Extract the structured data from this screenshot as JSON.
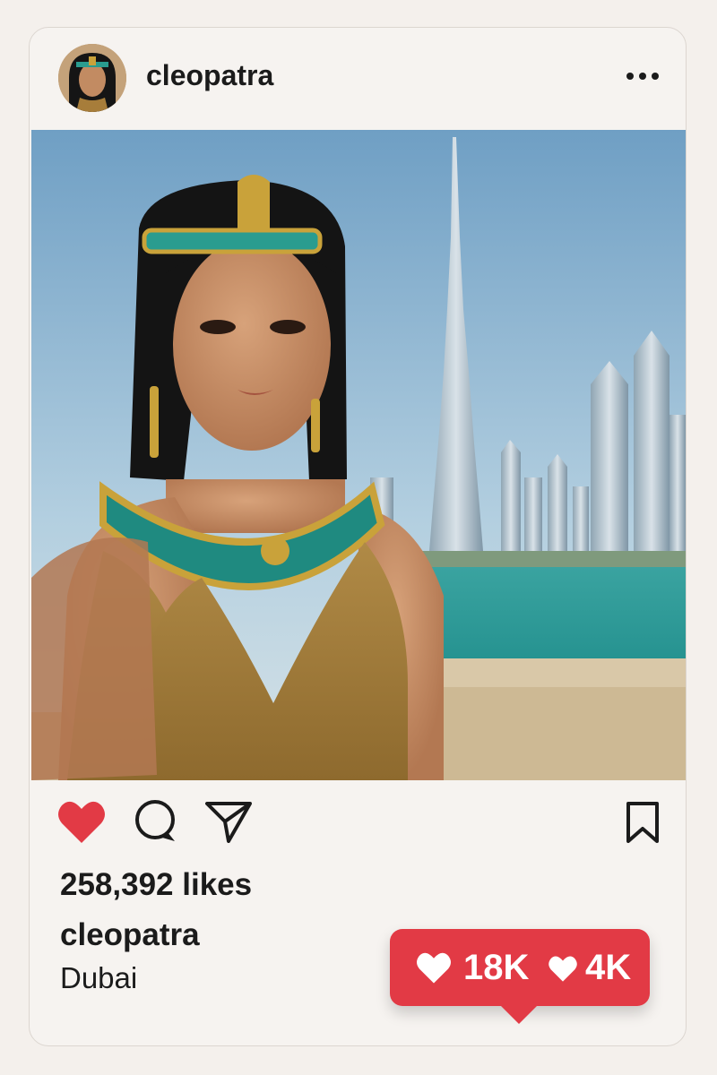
{
  "post": {
    "username": "cleopatra",
    "likes_text": "258,392 likes",
    "caption_username": "cleopatra",
    "location": "Dubai"
  },
  "notification": {
    "likes_count": "18K",
    "comments_count": "4K"
  },
  "icons": {
    "like": "heart-icon",
    "comment": "comment-icon",
    "share": "send-icon",
    "save": "bookmark-icon",
    "more": "more-options-icon"
  },
  "colors": {
    "like_red": "#e23a45",
    "text": "#1b1b1b",
    "card_bg": "#f6f3f0"
  }
}
